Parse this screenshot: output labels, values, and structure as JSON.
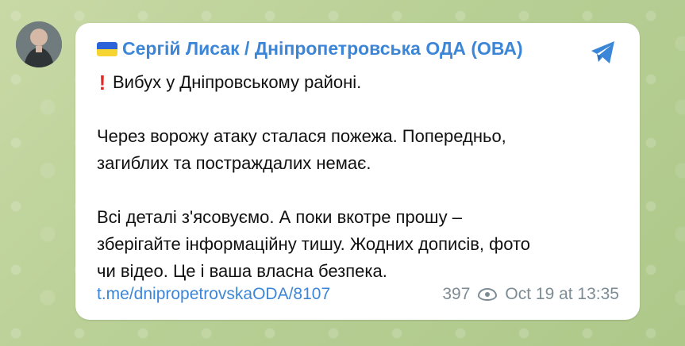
{
  "post": {
    "title": "Сергій Лисак / Дніпропетровська ОДА (ОВА)",
    "headline": "Вибух у Дніпровському районі.",
    "paragraph_1_line_1": "Через ворожу атаку сталася пожежа. Попередньо,",
    "paragraph_1_line_2": "загиблих та постраждалих немає.",
    "paragraph_2_line_1": "Всі деталі з'ясовуємо. А поки вкотре прошу –",
    "paragraph_2_line_2": "зберігайте інформаційну тишу. Жодних дописів, фото",
    "paragraph_2_line_3": "чи відео. Це і ваша власна безпека.",
    "link": "t.me/dnipropetrovskaODA/8107",
    "views": "397",
    "timestamp": "Oct 19 at 13:35",
    "icons": {
      "avatar": "avatar-image",
      "flag": "ukraine-flag-icon",
      "alert": "exclamation-icon",
      "share": "telegram-share-icon",
      "views": "eye-icon"
    },
    "colors": {
      "accent": "#3c86d8",
      "alert": "#e12a27",
      "meta": "#7d8b94",
      "bubble": "#ffffff",
      "background": "#b8cf95"
    }
  }
}
